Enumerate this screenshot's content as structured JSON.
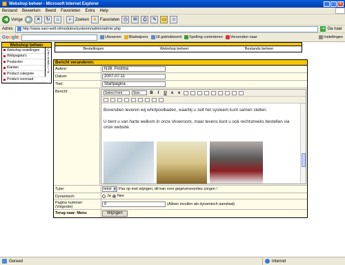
{
  "window": {
    "title": "Webshop beheer - Microsoft Internet Explorer",
    "btn_min": "_",
    "btn_max": "□",
    "btn_close": "×"
  },
  "menu": [
    "Bestand",
    "Bewerken",
    "Beeld",
    "Favorieten",
    "Extra",
    "Help"
  ],
  "toolbar": {
    "back": "Vorige",
    "search": "Zoeken",
    "favorites": "Favorieten"
  },
  "address": {
    "label": "Adres",
    "url": "http://www.sani-well.nl/modules/systeem/admin/admin.php",
    "go": "Ga naar"
  },
  "googlebar": {
    "logo": [
      "G",
      "o",
      "o",
      "g",
      "l",
      "e"
    ],
    "items": [
      "Uitvoeren",
      "Bladwijzers",
      "18 geblokkeerd",
      "Spelling controleren",
      "Verzenden naar",
      "Instellingen"
    ]
  },
  "sidebar": {
    "title": "Webshop beheer",
    "items": [
      "Webshop instellingen",
      "Webpagina's",
      "Producten",
      "Klanten",
      "Product categorie",
      "Product voorraad"
    ],
    "vertical": [
      "C",
      "a",
      "t",
      "e",
      "g",
      "o",
      "r",
      "i",
      "e"
    ]
  },
  "topnav": [
    "Bestellingen",
    "Webshop beheer",
    "Bestands beheer"
  ],
  "form": {
    "header": "Bericht veranderen:",
    "auteur_label": "Auteur:",
    "auteur_value": "NJB. Postma",
    "datum_label": "Datum:",
    "datum_value": "2007-07-11",
    "titel_label": "Titel:",
    "titel_value": "Startpagina",
    "bericht_label": "Bericht:",
    "editor": {
      "font_select": "Select Font",
      "size_select": "Size",
      "para1": "Bovendien leveren wij whirlpoolbaden, waarbij u zelf het systeem kunt samen stellen.",
      "para2": "U bent u van harte welkom in onze showroom, maar tevens kunt u ook rechtstreeks bestellen via onze website."
    },
    "type_label": "Type:",
    "type_value": "tekst",
    "type_note": "Pas op met wijzigen, dit kan voor gegevensverlies zorgen !",
    "dynamisch_label": "Dynamisch:",
    "opt_ja": "Ja",
    "opt_nee": "Nee",
    "pagina_label": "Pagina nummer: (Volgorde)",
    "pagina_value": "0",
    "pagina_note": "(Alleen invullen als dynamisch aanstaat)",
    "terug_label": "Terug naar: Menu",
    "submit_label": "Wijzigen"
  },
  "status": {
    "left": "Gereed",
    "zone": "Internet"
  },
  "colors": {
    "accent_yellow": "#f7c600",
    "title_blue": "#0247c0"
  }
}
